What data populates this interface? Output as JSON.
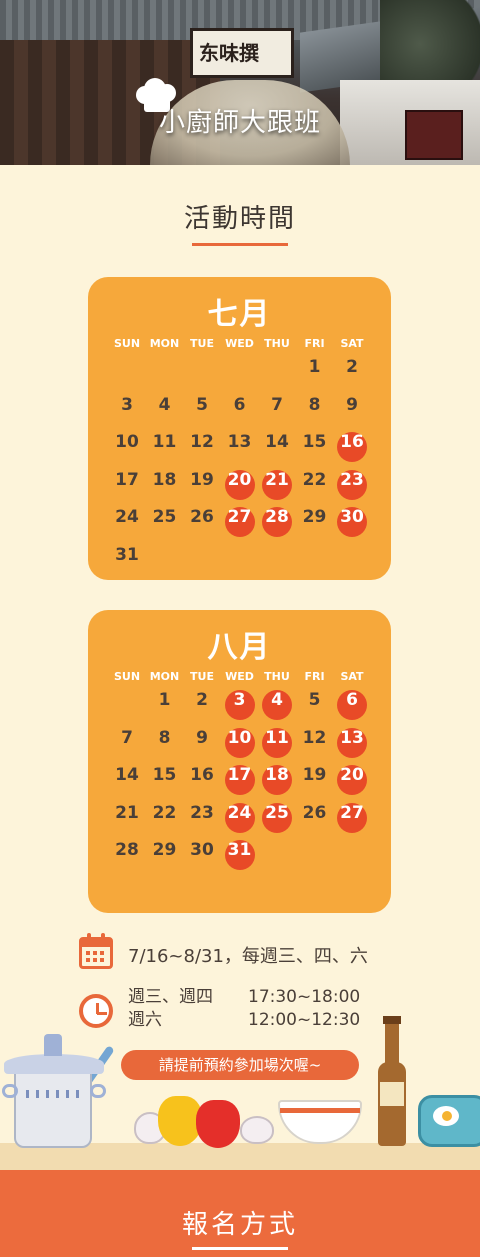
{
  "hero": {
    "title": "小廚師大跟班",
    "sign_text": "东味撰"
  },
  "section": {
    "title": "活動時間"
  },
  "weekdays": [
    "SUN",
    "MON",
    "TUE",
    "WED",
    "THU",
    "FRI",
    "SAT"
  ],
  "calendars": [
    {
      "month": "七月",
      "weeks": [
        [
          null,
          null,
          null,
          null,
          null,
          1,
          2
        ],
        [
          3,
          4,
          5,
          6,
          7,
          8,
          9
        ],
        [
          10,
          11,
          12,
          13,
          14,
          15,
          16
        ],
        [
          17,
          18,
          19,
          20,
          21,
          22,
          23
        ],
        [
          24,
          25,
          26,
          27,
          28,
          29,
          30
        ],
        [
          31,
          null,
          null,
          null,
          null,
          null,
          null
        ]
      ],
      "highlighted": [
        16,
        20,
        21,
        23,
        27,
        28,
        30
      ]
    },
    {
      "month": "八月",
      "weeks": [
        [
          null,
          1,
          2,
          3,
          4,
          5,
          6
        ],
        [
          7,
          8,
          9,
          10,
          11,
          12,
          13
        ],
        [
          14,
          15,
          16,
          17,
          18,
          19,
          20
        ],
        [
          21,
          22,
          23,
          24,
          25,
          26,
          27
        ],
        [
          28,
          29,
          30,
          31,
          null,
          null,
          null
        ]
      ],
      "highlighted": [
        3,
        4,
        6,
        10,
        11,
        13,
        17,
        18,
        20,
        24,
        25,
        27,
        31
      ]
    }
  ],
  "info": {
    "date_range": "7/16~8/31，每週三、四、六",
    "schedule": [
      {
        "days": "週三、週四",
        "time": "17:30~18:00"
      },
      {
        "days": "週六",
        "time": "12:00~12:30"
      }
    ],
    "notice": "請提前預約參加場次喔~"
  },
  "footer": {
    "title": "報名方式"
  },
  "colors": {
    "background": "#fdf4da",
    "calendar": "#f6a83b",
    "highlight": "#e84a27",
    "accent": "#e8683a",
    "footer": "#ec6b3d"
  },
  "icons": [
    "chef-hat-icon",
    "calendar-icon",
    "clock-icon"
  ]
}
